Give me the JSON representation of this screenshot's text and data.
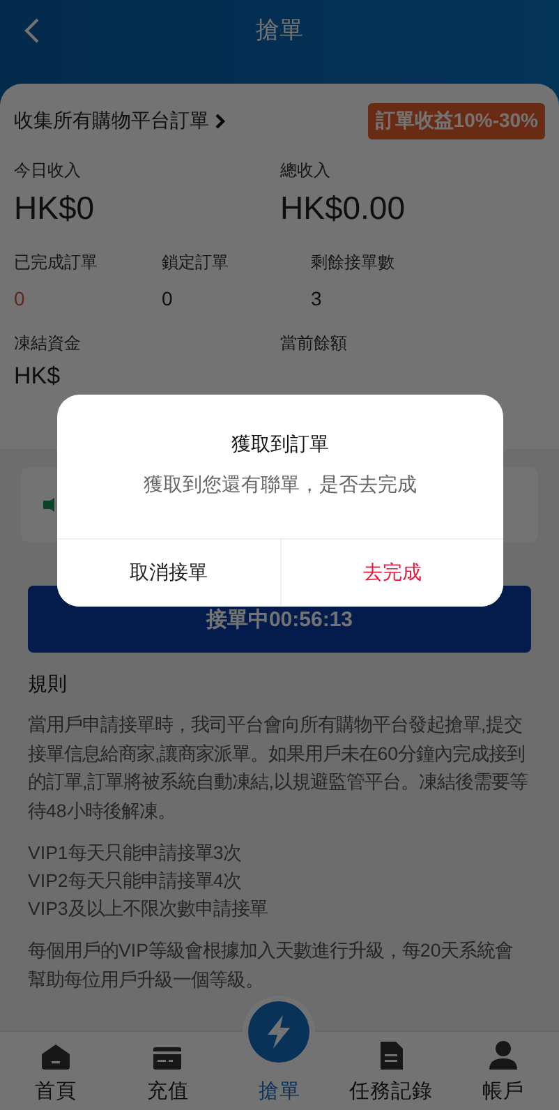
{
  "header": {
    "title": "搶單"
  },
  "card": {
    "link": "收集所有購物平台訂單",
    "badge": "訂單收益10%-30%",
    "income": [
      {
        "label": "今日收入",
        "value": "HK$0"
      },
      {
        "label": "總收入",
        "value": "HK$0.00"
      }
    ],
    "orders": [
      {
        "label": "已完成訂單",
        "value": "0",
        "highlight": true
      },
      {
        "label": "鎖定訂單",
        "value": "0",
        "highlight": false
      },
      {
        "label": "剩餘接單數",
        "value": "3",
        "highlight": false
      }
    ],
    "funds": [
      {
        "label": "凍結資金",
        "value": "HK$"
      },
      {
        "label": "當前餘額"
      }
    ]
  },
  "grab_button": "接單中00:56:13",
  "rules": {
    "title": "規則",
    "paragraphs": [
      "當用戶申請接單時，我司平台會向所有購物平台發起搶單,提交接單信息給商家,讓商家派單。如果用戶未在60分鐘內完成接到的訂單,訂單將被系統自動凍結,以規避監管平台。凍結後需要等待48小時後解凍。"
    ],
    "vip": [
      "VIP1每天只能申請接單3次",
      "VIP2每天只能申請接單4次",
      "VIP3及以上不限次數申請接單"
    ],
    "note": "每個用戶的VIP等級會根據加入天數進行升級，每20天系統會幫助每位用戶升級一個等級。"
  },
  "nav": [
    {
      "label": "首頁",
      "selected": false
    },
    {
      "label": "充值",
      "selected": false
    },
    {
      "label": "搶單",
      "selected": true
    },
    {
      "label": "任務記錄",
      "selected": false
    },
    {
      "label": "帳戶",
      "selected": false
    }
  ],
  "dialog": {
    "title": "獲取到訂單",
    "message": "獲取到您還有聯單，是否去完成",
    "buttons": [
      {
        "label": "取消接單",
        "kind": "cancel"
      },
      {
        "label": "去完成",
        "kind": "confirm"
      }
    ]
  }
}
